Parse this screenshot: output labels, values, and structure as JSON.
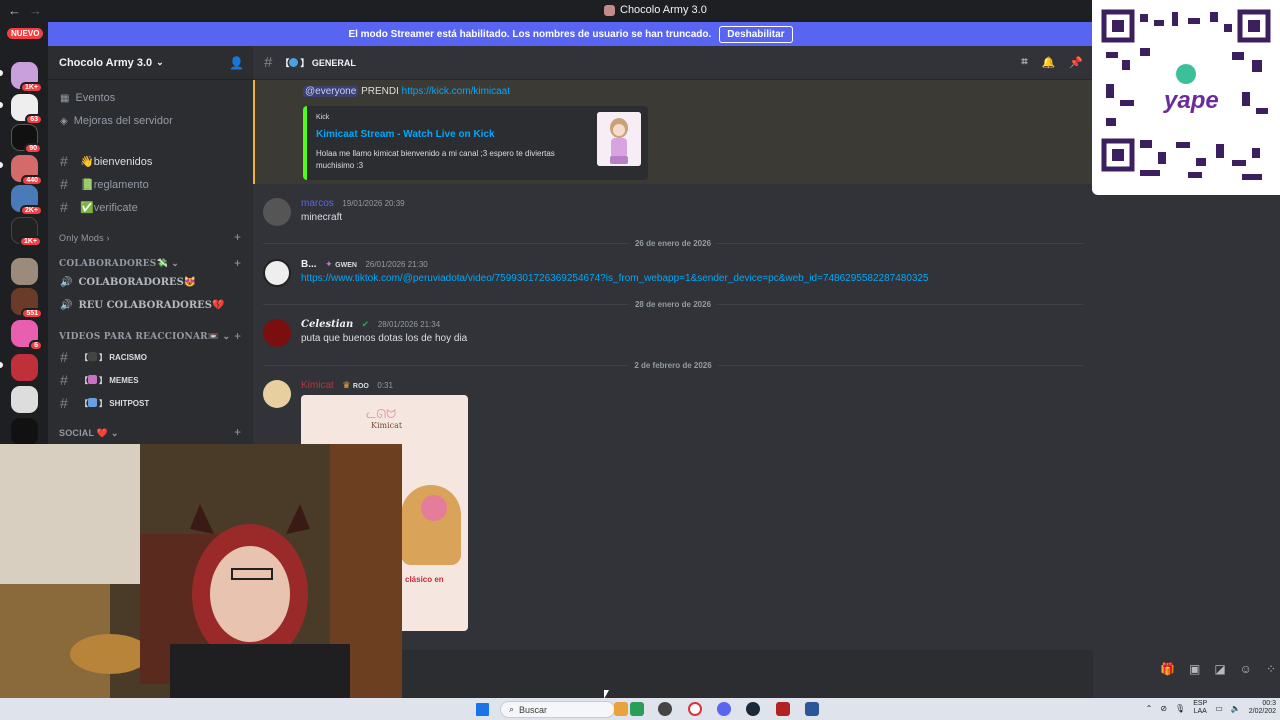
{
  "titlebar": {
    "title": "Chocolo Army 3.0"
  },
  "banner": {
    "text": "El modo Streamer está habilitado. Los nombres de usuario se han truncado.",
    "button": "Deshabilitar"
  },
  "rail": {
    "new_label": "NUEVO",
    "badges": [
      "1K+",
      "63",
      "90",
      "440",
      "2K+",
      "1K+",
      "551",
      "1K+",
      "6"
    ]
  },
  "sidebar": {
    "server_name": "Chocolo Army 3.0",
    "events": "Eventos",
    "boosts": "Mejoras del servidor",
    "channels_top": [
      "👋bienvenidos",
      "📗reglamento",
      "✅verificate"
    ],
    "only_mods": "Only Mods",
    "cat_colab": "COLABORADORES💸",
    "colab_voice": [
      "COLABORADORES😻",
      "REU COLABORADORES💔"
    ],
    "cat_videos": "VIDEOS PARA REACCIONAR📼",
    "video_channels": [
      "RACISMO",
      "MEMES",
      "SHITPOST"
    ],
    "cat_social": "SOCIAL ❤️"
  },
  "channel": {
    "name": "GENERAL"
  },
  "messages": {
    "m1": {
      "mention": "@everyone",
      "text": "PRENDI",
      "link": "https://kick.com/kimicaat",
      "embed_provider": "Kick",
      "embed_title": "Kimicaat Stream - Watch Live on Kick",
      "embed_desc": "Holaa me llamo kimicat bienvenido a mi canal ;3 espero te diviertas muchisimo :3"
    },
    "m2": {
      "author": "marcos",
      "time": "19/01/2026 20:39",
      "text": "minecraft"
    },
    "d1": "26 de enero de 2026",
    "m3": {
      "author": "B...",
      "tag": "GWEN",
      "time": "26/01/2026 21:30",
      "link": "https://www.tiktok.com/@peruviadota/video/7599301726369254674?is_from_webapp=1&sender_device=pc&web_id=7486295582287480325"
    },
    "d2": "28 de enero de 2026",
    "m4": {
      "author": "Celestian",
      "time": "28/01/2026 21:34",
      "text": "puta que buenos dotas los de hoy dia"
    },
    "d3": "2 de febrero de 2026",
    "m5": {
      "author": "Kimicat",
      "tag": "ROO",
      "time": "0:31",
      "image_title": "Kimicat",
      "image_sub": "clásico en"
    }
  },
  "taskbar": {
    "search": "Buscar",
    "lang": "ESP",
    "lang2": "LAA",
    "time": "00:3",
    "date": "2/02/202"
  },
  "colors": {
    "accent": "#5865f2",
    "link": "#00a8fc",
    "kick": "#53fc18",
    "bg": "#313338"
  }
}
